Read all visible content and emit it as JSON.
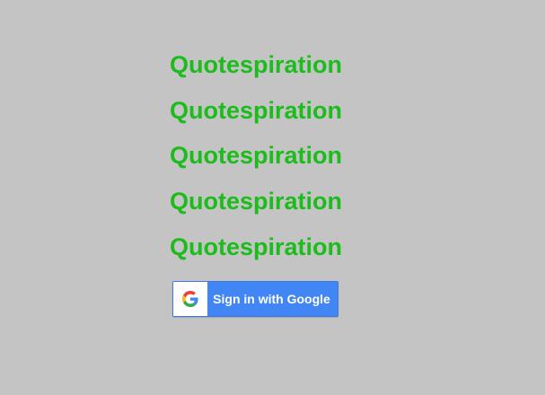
{
  "titles": [
    "Quotespiration",
    "Quotespiration",
    "Quotespiration",
    "Quotespiration",
    "Quotespiration"
  ],
  "signin": {
    "label": "Sign in with Google",
    "icon": "google-logo-icon"
  },
  "colors": {
    "background": "#c4c4c4",
    "title": "#1cbc1c",
    "button": "#4285f4"
  }
}
